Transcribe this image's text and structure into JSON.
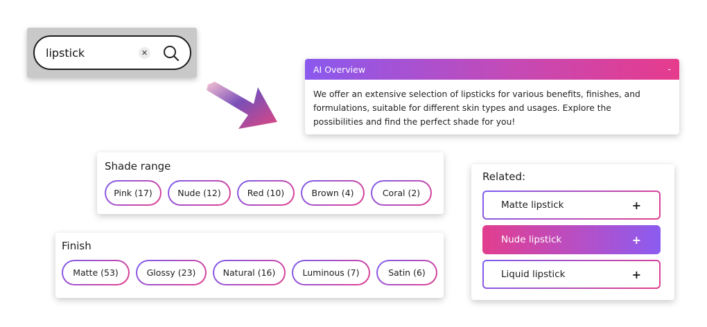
{
  "search": {
    "value": "lipstick",
    "clear_icon": "close-icon",
    "search_icon": "search-icon"
  },
  "ai_overview": {
    "title": "AI Overview",
    "collapse_symbol": "-",
    "lines": [
      "We offer an extensive selection of lipsticks for various benefits, finishes, and",
      "formulations, suitable for different skin types and usages. Explore the",
      "possibilities and find the perfect shade for you!"
    ]
  },
  "shade_range": {
    "title": "Shade range",
    "chips": [
      {
        "label": "Pink (17)"
      },
      {
        "label": "Nude (12)"
      },
      {
        "label": "Red (10)"
      },
      {
        "label": "Brown (4)"
      },
      {
        "label": "Coral (2)"
      }
    ]
  },
  "finish": {
    "title": "Finish",
    "chips": [
      {
        "label": "Matte (53)"
      },
      {
        "label": "Glossy (23)"
      },
      {
        "label": "Natural (16)"
      },
      {
        "label": "Luminous (7)"
      },
      {
        "label": "Satin (6)"
      }
    ]
  },
  "related": {
    "title": "Related:",
    "items": [
      {
        "label": "Matte lipstick",
        "symbol": "+",
        "active": false
      },
      {
        "label": "Nude lipstick",
        "symbol": "+",
        "active": true
      },
      {
        "label": "Liquid lipstick",
        "symbol": "+",
        "active": false
      }
    ]
  },
  "colors": {
    "gradient_purple": "#8a59ee",
    "gradient_pink": "#e63b8c",
    "search_panel_bg": "#c9c9c9"
  }
}
